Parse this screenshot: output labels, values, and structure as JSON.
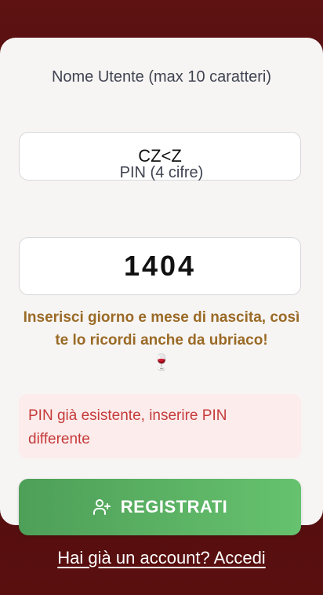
{
  "form": {
    "username_label": "Nome Utente (max 10 caratteri)",
    "username_value": "CZ<Z",
    "pin_label": "PIN (4 cifre)",
    "pin_value": "1404",
    "hint_text": "Inserisci giorno e mese di nascita, così te lo ricordi anche da ubriaco!",
    "hint_icon": "🍷",
    "error_message": "PIN già esistente, inserire PIN differente",
    "register_button": "REGISTRATI",
    "register_icon": "user-plus-icon"
  },
  "footer": {
    "login_link": "Hai già un account? Accedi"
  },
  "colors": {
    "background": "#5a0f0f",
    "card": "#f7f5f4",
    "hint": "#9a6a26",
    "error_text": "#c63a3a",
    "error_bg": "#fcecec",
    "button_start": "#4e9f58",
    "button_end": "#66c26e"
  }
}
